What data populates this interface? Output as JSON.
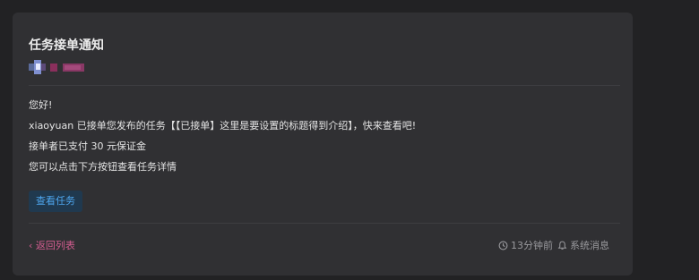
{
  "notification": {
    "title": "任务接单通知",
    "greeting": "您好!",
    "line1": "xiaoyuan 已接单您发布的任务【【已接单】这里是要设置的标题得到介绍】，快来查看吧!",
    "line2": "接单者已支付 30 元保证金",
    "line3": "您可以点击下方按钮查看任务详情",
    "view_button": "查看任务"
  },
  "footer": {
    "back_link": "‹ 返回列表",
    "time_ago": "13分钟前",
    "category": "系统消息",
    "icons": [
      "clock-icon",
      "bell-icon"
    ]
  },
  "colors": {
    "background": "#222224",
    "card": "#303033",
    "accent_blue": "#4ea6ee",
    "accent_pink": "#d35d90"
  }
}
